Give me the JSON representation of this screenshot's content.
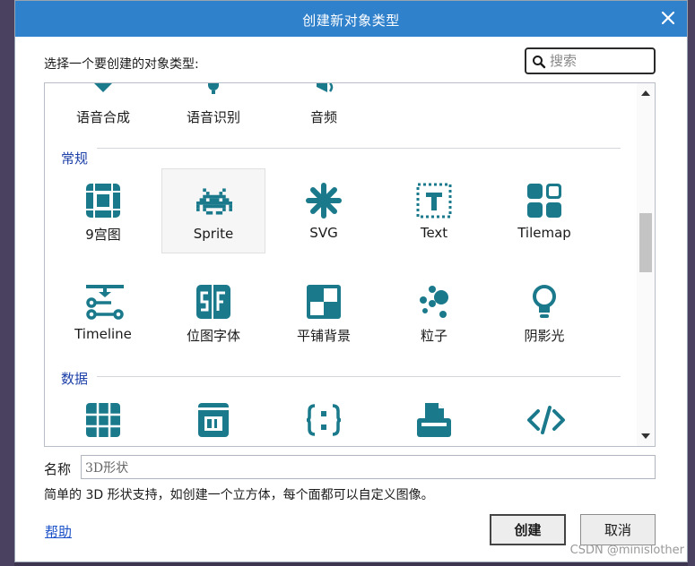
{
  "dialog": {
    "title": "创建新对象类型",
    "prompt": "选择一个要创建的对象类型:",
    "search_placeholder": "搜索"
  },
  "top_row": [
    {
      "label": "语音合成",
      "icon": "speech-synthesis-icon"
    },
    {
      "label": "语音识别",
      "icon": "speech-recognition-icon"
    },
    {
      "label": "音频",
      "icon": "audio-icon"
    }
  ],
  "sections": [
    {
      "title": "常规",
      "items": [
        {
          "label": "9宫图",
          "icon": "nine-patch-icon"
        },
        {
          "label": "Sprite",
          "icon": "sprite-icon",
          "selected": true
        },
        {
          "label": "SVG",
          "icon": "svg-icon"
        },
        {
          "label": "Text",
          "icon": "text-icon"
        },
        {
          "label": "Tilemap",
          "icon": "tilemap-icon"
        },
        {
          "label": "Timeline",
          "icon": "timeline-icon"
        },
        {
          "label": "位图字体",
          "icon": "bitmap-font-icon"
        },
        {
          "label": "平铺背景",
          "icon": "tiled-background-icon"
        },
        {
          "label": "粒子",
          "icon": "particles-icon"
        },
        {
          "label": "阴影光",
          "icon": "shadow-light-icon"
        }
      ]
    },
    {
      "title": "数据",
      "items": [
        {
          "label": "",
          "icon": "array-icon"
        },
        {
          "label": "",
          "icon": "binary-data-icon"
        },
        {
          "label": "",
          "icon": "dictionary-icon"
        },
        {
          "label": "",
          "icon": "printer-icon"
        },
        {
          "label": "",
          "icon": "xml-icon"
        }
      ]
    }
  ],
  "name_field": {
    "label": "名称",
    "value": "3D形状"
  },
  "description": "简单的 3D 形状支持，如创建一个立方体，每个面都可以自定义图像。",
  "help_link": "帮助",
  "buttons": {
    "create": "创建",
    "cancel": "取消"
  },
  "watermark": "CSDN @minislother",
  "colors": {
    "titlebar": "#3081cc",
    "icon": "#1a7a8c",
    "section_title": "#1c3fa8"
  }
}
